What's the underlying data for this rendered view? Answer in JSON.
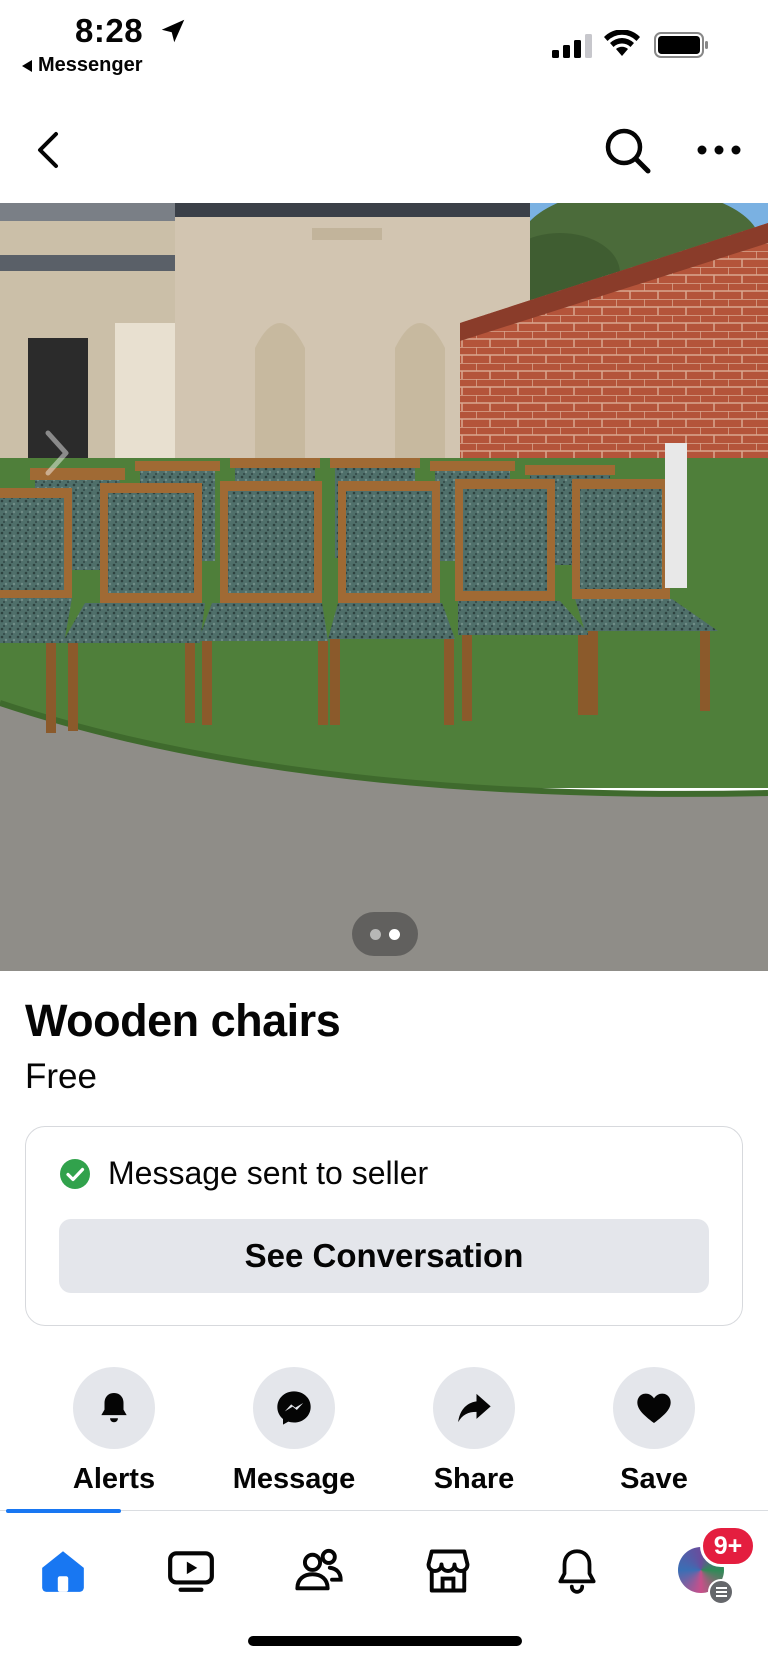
{
  "status_bar": {
    "time": "8:28",
    "back_app": "Messenger"
  },
  "top_nav": {
    "back_icon": "chevron-left-icon",
    "search_icon": "search-icon",
    "more_icon": "more-horizontal-icon"
  },
  "photo": {
    "description_icon": "listing-photo",
    "carousel_total": 2,
    "carousel_active": 2
  },
  "listing": {
    "title": "Wooden chairs",
    "price": "Free"
  },
  "message_card": {
    "status_text": "Message sent to seller",
    "status_icon": "check-circle-icon",
    "button_label": "See Conversation"
  },
  "actions": [
    {
      "label": "Alerts",
      "icon": "bell-icon"
    },
    {
      "label": "Message",
      "icon": "messenger-icon"
    },
    {
      "label": "Share",
      "icon": "share-arrow-icon"
    },
    {
      "label": "Save",
      "icon": "heart-icon"
    }
  ],
  "tabbar": {
    "tabs": [
      "home-icon",
      "video-icon",
      "friends-icon",
      "marketplace-icon",
      "notifications-icon",
      "profile-avatar"
    ],
    "badge": "9+"
  },
  "colors": {
    "accent": "#1877f2",
    "success": "#31a24c",
    "badge": "#e41e3f",
    "button_bg": "#e4e6eb"
  }
}
